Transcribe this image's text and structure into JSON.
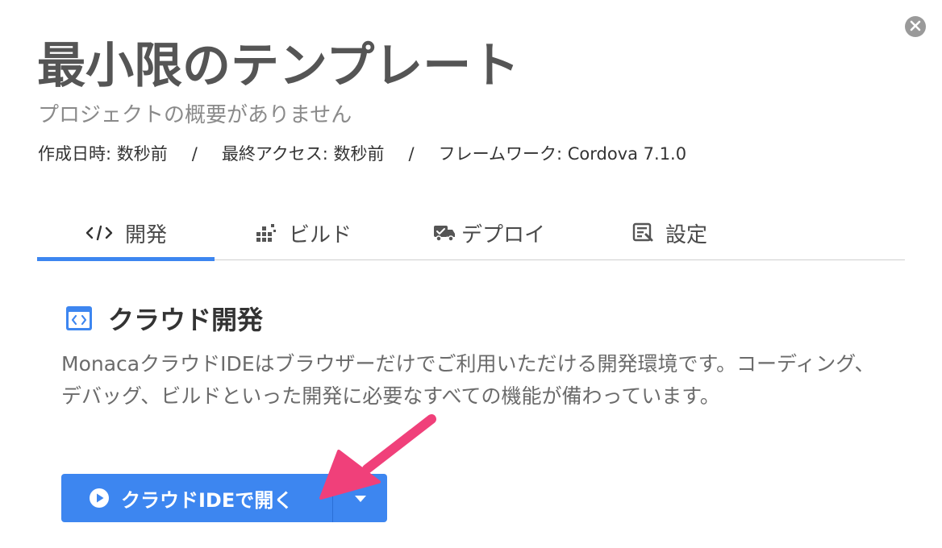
{
  "header": {
    "title": "最小限のテンプレート",
    "subtitle": "プロジェクトの概要がありません",
    "meta": {
      "created": "作成日時: 数秒前",
      "separator": "/",
      "last_access": "最終アクセス: 数秒前",
      "framework": "フレームワーク: Cordova 7.1.0"
    }
  },
  "tabs": [
    {
      "label": "開発",
      "icon": "code-icon",
      "active": true
    },
    {
      "label": "ビルド",
      "icon": "build-blocks-icon",
      "active": false
    },
    {
      "label": "デプロイ",
      "icon": "delivery-truck-icon",
      "active": false
    },
    {
      "label": "設定",
      "icon": "settings-form-icon",
      "active": false
    }
  ],
  "section": {
    "icon": "code-window-icon",
    "title": "クラウド開発",
    "description": "MonacaクラウドIDEはブラウザーだけでご利用いただける開発環境です。コーディング、デバッグ、ビルドといった開発に必要なすべての機能が備わっています。"
  },
  "open_button": {
    "label": "クラウドIDEで開く",
    "icon": "play-circle-icon",
    "dropdown_icon": "caret-down-icon"
  },
  "colors": {
    "accent": "#3d86f0",
    "annotation_arrow": "#f0407a"
  }
}
